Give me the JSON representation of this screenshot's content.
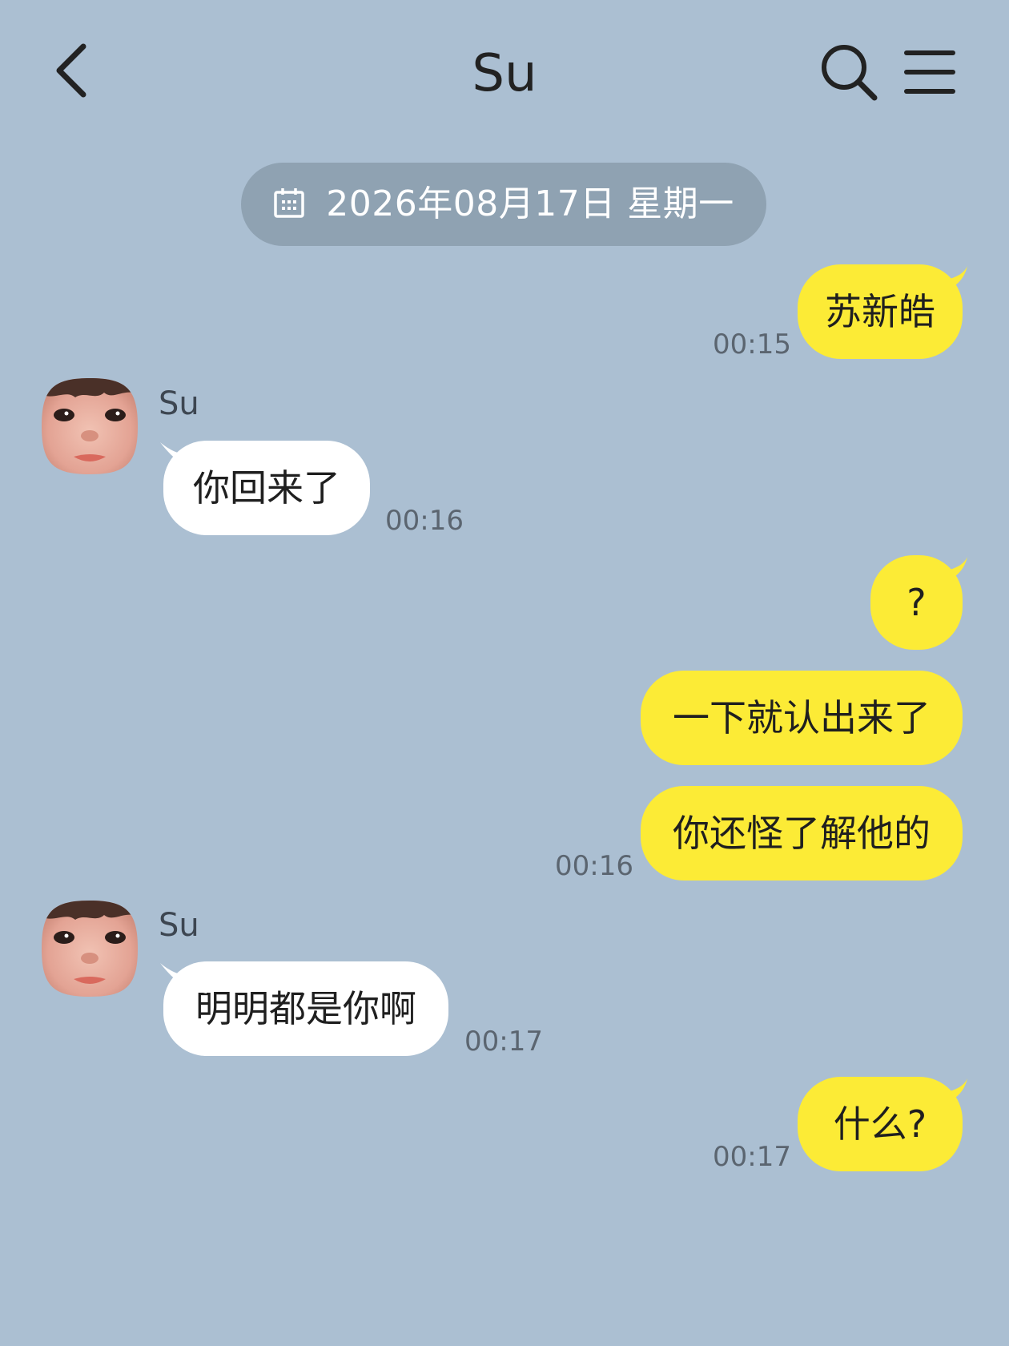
{
  "header": {
    "back_icon": "chevron-left-icon",
    "title": "Su",
    "search_icon": "search-icon",
    "menu_icon": "hamburger-menu-icon"
  },
  "date_divider": {
    "icon": "calendar-icon",
    "text": "2026年08月17日 星期一"
  },
  "messages": [
    {
      "direction": "outgoing",
      "text": "苏新皓",
      "time": "00:15"
    },
    {
      "direction": "incoming",
      "sender": "Su",
      "text": "你回来了",
      "time": "00:16"
    },
    {
      "direction": "outgoing",
      "text": "?"
    },
    {
      "direction": "outgoing",
      "text": "一下就认出来了"
    },
    {
      "direction": "outgoing",
      "text": "你还怪了解他的",
      "time": "00:16"
    },
    {
      "direction": "incoming",
      "sender": "Su",
      "text": "明明都是你啊",
      "time": "00:17"
    },
    {
      "direction": "outgoing",
      "text": "什么?",
      "time": "00:17"
    }
  ],
  "colors": {
    "background": "#abbfd2",
    "outgoing_bubble": "#fceb36",
    "incoming_bubble": "#ffffff",
    "date_pill": "#8fa2b2"
  }
}
